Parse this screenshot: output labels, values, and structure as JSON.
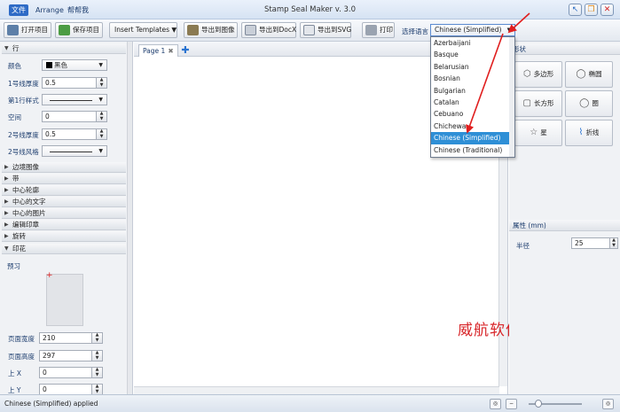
{
  "window": {
    "title": "Stamp Seal Maker v. 3.0"
  },
  "menu": [
    "文件",
    "Arrange",
    "帮帮我"
  ],
  "toolbar": {
    "open": "打开项目",
    "save": "保存项目",
    "insert_templates": "Insert Templates ▼",
    "export_image": "导出到图像",
    "export_docx": "导出到DocX",
    "export_svg": "导出到SVG",
    "print": "打印",
    "language_label": "选择语言",
    "language_value": "Chinese (Simplified)"
  },
  "language_list": [
    "Azerbaijani",
    "Basque",
    "Belarusian",
    "Bosnian",
    "Bulgarian",
    "Catalan",
    "Cebuano",
    "Chichewa",
    "Chinese (Simplified)",
    "Chinese (Traditional)"
  ],
  "language_selected_index": 8,
  "left_panel": {
    "line_section": "行",
    "color_label": "颜色",
    "color_value": "黑色",
    "line1_width_label": "1号线厚度",
    "line1_width": "0.5",
    "line1_style_label": "第1行样式",
    "space_label": "空间",
    "space_value": "0",
    "line2_width_label": "2号线厚度",
    "line2_width": "0.5",
    "line2_style_label": "2号线风格",
    "sections": [
      "边境图像",
      "带",
      "中心轮廓",
      "中心的文字",
      "中心的图片",
      "编辑印章",
      "旋转"
    ],
    "print_section": "印花",
    "preview_label": "预习",
    "page_width_label": "页面宽度",
    "page_width": "210",
    "page_height_label": "页面高度",
    "page_height": "297",
    "top_x_label": "上 X",
    "top_x": "0",
    "top_y_label": "上 Y",
    "top_y": "0"
  },
  "canvas": {
    "tab_label": "Page 1"
  },
  "right_panel": {
    "shapes_header": "形状",
    "shapes": [
      "多边形",
      "椭圆",
      "长方形",
      "圈",
      "星",
      "折线"
    ],
    "props_header": "属性 (mm)",
    "radius_label": "半径",
    "radius_value": "25"
  },
  "watermark": "威航软件园",
  "status": {
    "text": "Chinese (Simplified) applied"
  },
  "colors": {
    "accent": "#2e6bc6",
    "selection": "#2e8fd6",
    "arrow": "#e01e1e",
    "watermark": "#d8262a"
  }
}
